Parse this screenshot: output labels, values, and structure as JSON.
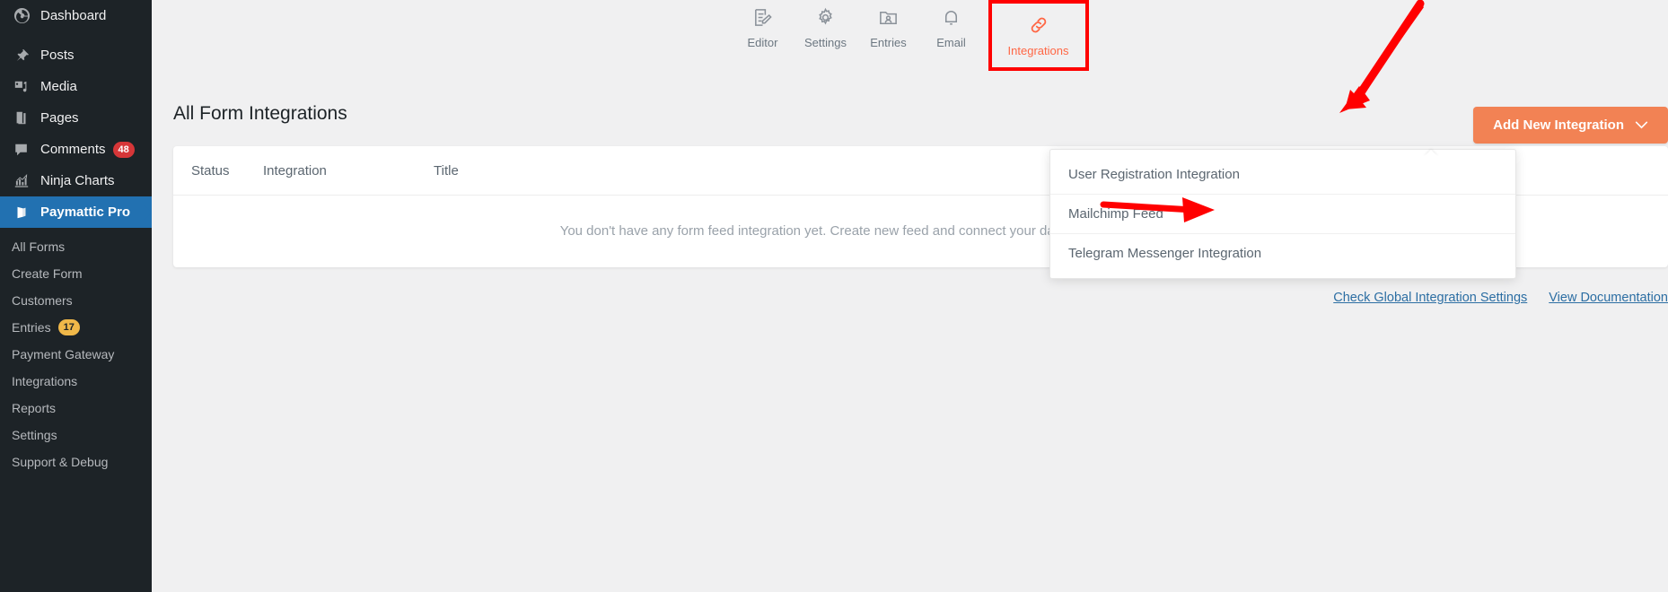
{
  "sidebar": {
    "items": [
      {
        "label": "Dashboard",
        "icon": "dashboard-icon"
      },
      {
        "label": "Posts",
        "icon": "pin-icon"
      },
      {
        "label": "Media",
        "icon": "media-icon"
      },
      {
        "label": "Pages",
        "icon": "pages-icon"
      },
      {
        "label": "Comments",
        "icon": "comment-icon",
        "badge": "48"
      },
      {
        "label": "Ninja Charts",
        "icon": "chart-icon"
      },
      {
        "label": "Paymattic Pro",
        "icon": "paymattic-icon",
        "active": true
      }
    ],
    "submenu": [
      {
        "label": "All Forms"
      },
      {
        "label": "Create Form"
      },
      {
        "label": "Customers"
      },
      {
        "label": "Entries",
        "badge": "17"
      },
      {
        "label": "Payment Gateway"
      },
      {
        "label": "Integrations"
      },
      {
        "label": "Reports"
      },
      {
        "label": "Settings"
      },
      {
        "label": "Support & Debug"
      }
    ]
  },
  "tabs": [
    {
      "label": "Editor",
      "icon": "editor-icon",
      "active": false
    },
    {
      "label": "Settings",
      "icon": "gear-icon",
      "active": false
    },
    {
      "label": "Entries",
      "icon": "entries-folder-icon",
      "active": false
    },
    {
      "label": "Email",
      "icon": "bell-icon",
      "active": false
    },
    {
      "label": "Integrations",
      "icon": "link-icon",
      "active": true
    }
  ],
  "main": {
    "page_title": "All Form Integrations",
    "add_button_label": "Add New Integration",
    "table_headers": {
      "status": "Status",
      "integration": "Integration",
      "title": "Title"
    },
    "empty_message": "You don't have any form feed integration yet. Create new feed and connect your data to your favorite CRM/Marketing tool",
    "footer_links": [
      {
        "label": "Check Global Integration Settings"
      },
      {
        "label": "View Documentation"
      }
    ]
  },
  "dropdown": {
    "items": [
      {
        "label": "User Registration Integration"
      },
      {
        "label": "Mailchimp Feed"
      },
      {
        "label": "Telegram Messenger Integration"
      }
    ]
  },
  "colors": {
    "accent_orange": "#f28254",
    "tab_active": "#ff6644",
    "sidebar_bg": "#1d2327",
    "sidebar_active": "#2271b1",
    "annotation_red": "#ff0000",
    "link_blue": "#2c6ea3",
    "badge_red": "#d63638",
    "badge_amber": "#f0b849"
  }
}
